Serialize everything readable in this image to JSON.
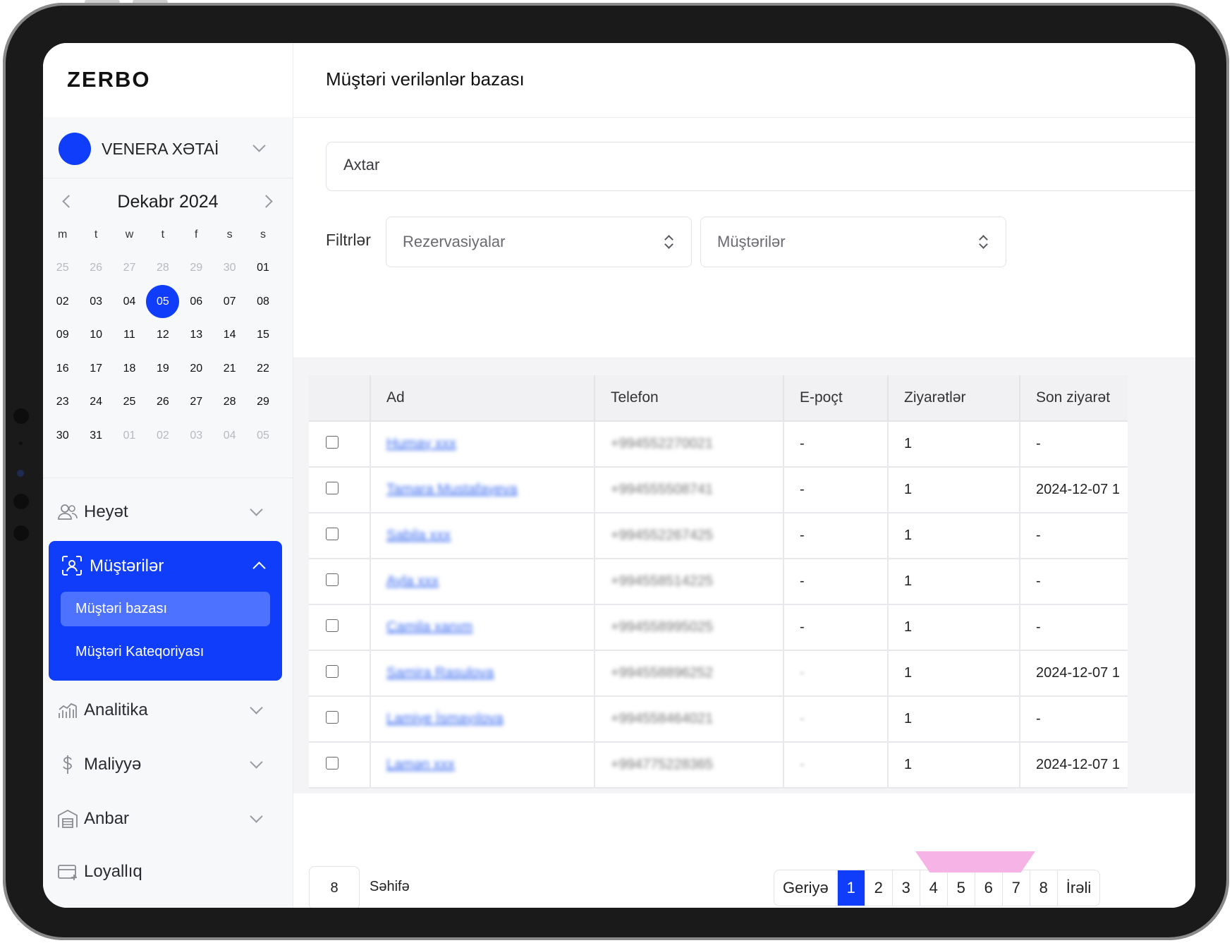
{
  "brand": "ZERBO",
  "page_title": "Müştəri verilənlər bazası",
  "user": {
    "name": "VENERA XƏTAİ"
  },
  "calendar": {
    "title": "Dekabr 2024",
    "weekdays": [
      "m",
      "t",
      "w",
      "t",
      "f",
      "s",
      "s"
    ],
    "weeks": [
      [
        "25",
        "26",
        "27",
        "28",
        "29",
        "30",
        "01"
      ],
      [
        "02",
        "03",
        "04",
        "05",
        "06",
        "07",
        "08"
      ],
      [
        "09",
        "10",
        "11",
        "12",
        "13",
        "14",
        "15"
      ],
      [
        "16",
        "17",
        "18",
        "19",
        "20",
        "21",
        "22"
      ],
      [
        "23",
        "24",
        "25",
        "26",
        "27",
        "28",
        "29"
      ],
      [
        "30",
        "31",
        "01",
        "02",
        "03",
        "04",
        "05"
      ]
    ],
    "selected": "05"
  },
  "nav": {
    "team": "Heyət",
    "customers": "Müştərilər",
    "customer_base": "Müştəri bazası",
    "customer_category": "Müştəri Kateqoriyası",
    "analytics": "Analitika",
    "finance": "Maliyyə",
    "warehouse": "Anbar",
    "loyalty": "Loyallıq"
  },
  "search": {
    "placeholder": "Axtar"
  },
  "filters": {
    "label": "Filtrlər",
    "reservations": "Rezervasiyalar",
    "customers": "Müştərilər"
  },
  "table": {
    "columns": [
      "Ad",
      "Telefon",
      "E-poçt",
      "Ziyarətlər",
      "Son ziyarət"
    ],
    "rows": [
      {
        "name": "Humay xxx",
        "phone": "+994552270021",
        "email": "-",
        "visits": "1",
        "last": "-"
      },
      {
        "name": "Tamara Mustafayeva",
        "phone": "+994555508741",
        "email": "-",
        "visits": "1",
        "last": "2024-12-07 1"
      },
      {
        "name": "Sabila xxx",
        "phone": "+994552267425",
        "email": "-",
        "visits": "1",
        "last": "-"
      },
      {
        "name": "Ayla xxx",
        "phone": "+994558514225",
        "email": "-",
        "visits": "1",
        "last": "-"
      },
      {
        "name": "Camila xanım",
        "phone": "+994558995025",
        "email": "-",
        "visits": "1",
        "last": "-"
      },
      {
        "name": "Samira Rasulova",
        "phone": "+994558896252",
        "email": "-",
        "visits": "1",
        "last": "2024-12-07 1"
      },
      {
        "name": "Lamiye İsmayılova",
        "phone": "+994558464021",
        "email": "-",
        "visits": "1",
        "last": "-"
      },
      {
        "name": "Lamən xxx",
        "phone": "+994775228365",
        "email": "-",
        "visits": "1",
        "last": "2024-12-07 1"
      }
    ]
  },
  "pagination": {
    "page_size": "8",
    "page_size_label": "Səhifə",
    "prev": "Geriyə",
    "next": "İrəli",
    "pages": [
      "1",
      "2",
      "3",
      "4",
      "5",
      "6",
      "7",
      "8"
    ],
    "current": "1"
  },
  "colors": {
    "accent": "#0f3dfa",
    "accent_light": "#4d72ff"
  }
}
